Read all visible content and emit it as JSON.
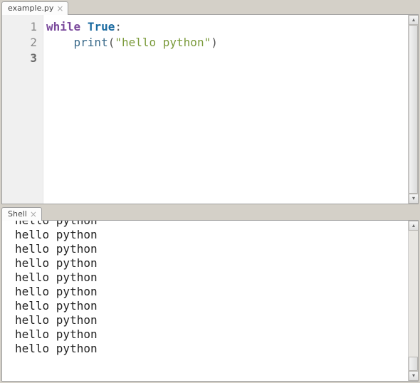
{
  "editor": {
    "tab_label": "example.py",
    "line_numbers": [
      "1",
      "2",
      "3"
    ],
    "code": {
      "line1": {
        "kw": "while",
        "sp": " ",
        "bool": "True",
        "colon": ":"
      },
      "line2": {
        "indent": "    ",
        "fn": "print",
        "open": "(",
        "str": "\"hello python\"",
        "close": ")"
      }
    }
  },
  "shell": {
    "tab_label": "Shell",
    "output_line": "hello python",
    "visible_lines": 10
  }
}
